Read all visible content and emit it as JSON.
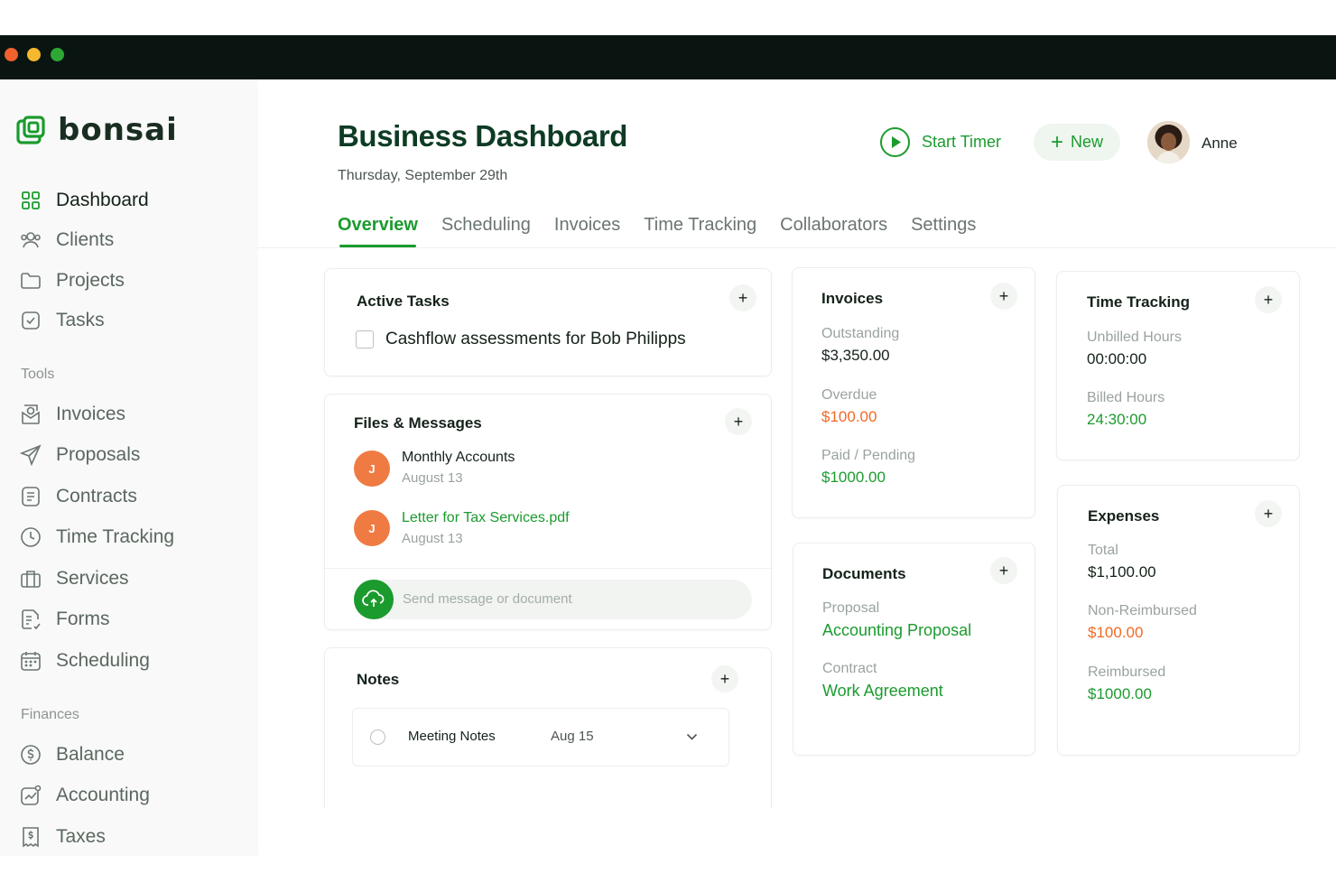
{
  "window": {
    "dots": [
      "#f0612e",
      "#f5b82e",
      "#2ea835"
    ]
  },
  "brand": {
    "name": "bonsai",
    "color": "#1b9b2e"
  },
  "sidebar": {
    "main": [
      {
        "label": "Dashboard",
        "icon": "grid-icon",
        "active": true
      },
      {
        "label": "Clients",
        "icon": "users-icon"
      },
      {
        "label": "Projects",
        "icon": "folder-icon"
      },
      {
        "label": "Tasks",
        "icon": "checkbox-icon"
      }
    ],
    "tools_label": "Tools",
    "tools": [
      {
        "label": "Invoices",
        "icon": "invoice-icon"
      },
      {
        "label": "Proposals",
        "icon": "send-icon"
      },
      {
        "label": "Contracts",
        "icon": "document-icon"
      },
      {
        "label": "Time Tracking",
        "icon": "clock-icon"
      },
      {
        "label": "Services",
        "icon": "briefcase-icon"
      },
      {
        "label": "Forms",
        "icon": "form-icon"
      },
      {
        "label": "Scheduling",
        "icon": "calendar-icon"
      }
    ],
    "finances_label": "Finances",
    "finances": [
      {
        "label": "Balance",
        "icon": "dollar-circle-icon"
      },
      {
        "label": "Accounting",
        "icon": "chart-icon"
      },
      {
        "label": "Taxes",
        "icon": "receipt-icon"
      }
    ]
  },
  "header": {
    "title": "Business Dashboard",
    "date": "Thursday, September 29th",
    "start_timer": "Start Timer",
    "new_label": "New",
    "user": "Anne"
  },
  "tabs": [
    "Overview",
    "Scheduling",
    "Invoices",
    "Time Tracking",
    "Collaborators",
    "Settings"
  ],
  "active_tasks": {
    "title": "Active Tasks",
    "items": [
      "Cashflow assessments for Bob Philipps"
    ]
  },
  "files": {
    "title": "Files & Messages",
    "items": [
      {
        "initial": "J",
        "title": "Monthly Accounts",
        "date": "August 13"
      },
      {
        "initial": "J",
        "title": "Letter for Tax Services.pdf",
        "date": "August 13"
      }
    ],
    "placeholder": "Send message or document"
  },
  "notes": {
    "title": "Notes",
    "items": [
      {
        "title": "Meeting Notes",
        "date": "Aug 15"
      }
    ]
  },
  "invoices": {
    "title": "Invoices",
    "outstanding_label": "Outstanding",
    "outstanding": "$3,350.00",
    "overdue_label": "Overdue",
    "overdue": "$100.00",
    "paid_label": "Paid / Pending",
    "paid": "$1000.00"
  },
  "documents": {
    "title": "Documents",
    "proposal_label": "Proposal",
    "proposal": "Accounting Proposal",
    "contract_label": "Contract",
    "contract": "Work Agreement"
  },
  "time_tracking": {
    "title": "Time Tracking",
    "unbilled_label": "Unbilled Hours",
    "unbilled": "00:00:00",
    "billed_label": "Billed Hours",
    "billed": "24:30:00"
  },
  "expenses": {
    "title": "Expenses",
    "total_label": "Total",
    "total": "$1,100.00",
    "nonreimb_label": "Non-Reimbursed",
    "nonreimb": "$100.00",
    "reimb_label": "Reimbursed",
    "reimb": "$1000.00"
  }
}
